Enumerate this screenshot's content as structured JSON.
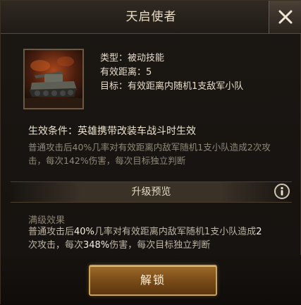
{
  "dialog": {
    "title": "天启使者"
  },
  "skill": {
    "type_line": "类型：被动技能",
    "range_line": "有效距离：5",
    "target_line": "目标：有效距离内随机1支敌军小队"
  },
  "condition": {
    "title": "生效条件：英雄携带改装车战斗时生效",
    "desc_line1": "普通攻击后40%几率对有效距离内敌军随机1支小队造成2次攻",
    "desc_line2": "击，每次142%伤害，每次目标独立判断"
  },
  "upgrade": {
    "section_title": "升级预览",
    "max_label": "满级效果",
    "max_line1": {
      "a": "普通攻击后",
      "b": "40%",
      "c": "几率对有效距离内敌军随机1支小队造成",
      "d": "2"
    },
    "max_line2": {
      "a": "次攻击，每次",
      "b": "348%",
      "c": "伤害，每次目标独立判断"
    }
  },
  "actions": {
    "unlock_label": "解锁"
  },
  "colors": {
    "accent_gold": "#c8a15a",
    "text_light": "#e6dccb",
    "text_dim": "#8f8878"
  },
  "icons": {
    "close": "close-icon",
    "info": "info-icon",
    "skill": "tank-skill-icon"
  }
}
